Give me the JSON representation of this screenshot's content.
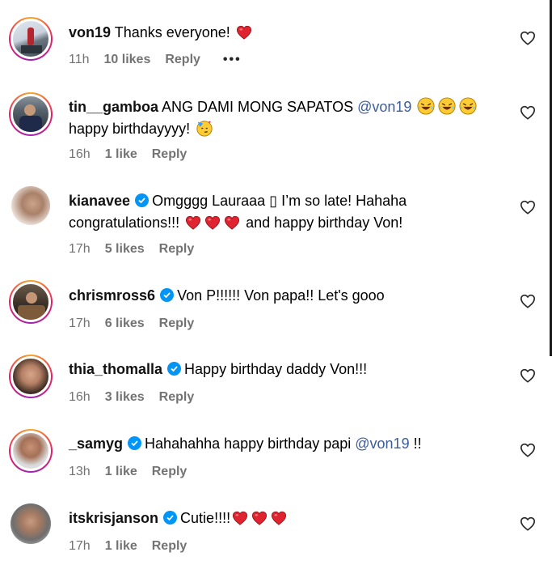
{
  "comments": [
    {
      "username": "von19",
      "verified": false,
      "text1": "Thanks everyone!",
      "time": "11h",
      "likes": "10 likes",
      "reply": "Reply",
      "more": "•••"
    },
    {
      "username": "tin__gamboa",
      "verified": false,
      "text1": "ANG DAMI MONG SAPATOS",
      "mention": "@von19",
      "text2": "happy birthdayyyy!",
      "time": "16h",
      "likes": "1 like",
      "reply": "Reply"
    },
    {
      "username": "kianavee",
      "verified": true,
      "text1": "Omgggg Lauraaa ▯ I’m so late! Hahaha",
      "text2a": "congratulations!!!",
      "text2b": "and happy birthday Von!",
      "time": "17h",
      "likes": "5 likes",
      "reply": "Reply"
    },
    {
      "username": "chrismross6",
      "verified": true,
      "text1": "Von P!!!!!! Von papa!! Let's gooo",
      "time": "17h",
      "likes": "6 likes",
      "reply": "Reply"
    },
    {
      "username": "thia_thomalla",
      "verified": true,
      "text1": "Happy birthday daddy Von!!!",
      "time": "16h",
      "likes": "3 likes",
      "reply": "Reply"
    },
    {
      "username": "_samyg",
      "verified": true,
      "text1": "Hahahahha happy birthday papi",
      "mention": "@von19",
      "text1b": "!!",
      "time": "13h",
      "likes": "1 like",
      "reply": "Reply"
    },
    {
      "username": "itskrisjanson",
      "verified": true,
      "text1": "Cutie!!!!",
      "time": "17h",
      "likes": "1 like",
      "reply": "Reply"
    }
  ],
  "colors": {
    "verified": "#0095f6",
    "mention": "#3b5d9a",
    "meta": "#737373",
    "heart": "#e0242f"
  },
  "icons": {
    "like": "heart-outline-icon",
    "verified": "verified-badge-icon"
  }
}
